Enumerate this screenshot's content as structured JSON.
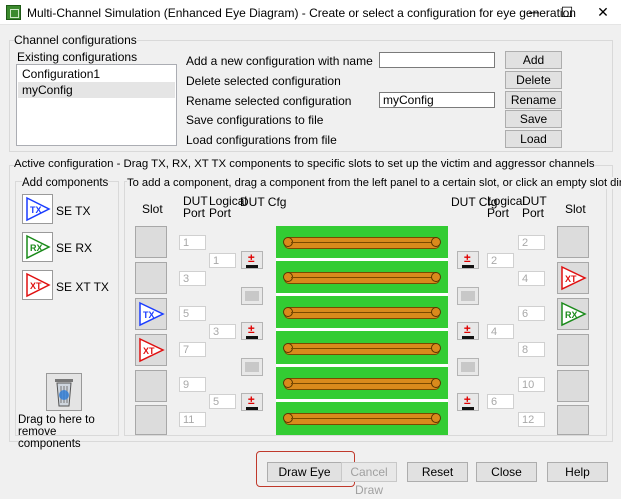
{
  "window": {
    "title": "Multi-Channel Simulation (Enhanced Eye Diagram) - Create or select a configuration for eye generation",
    "minimize": "─",
    "maximize": "☐",
    "close": "✕"
  },
  "channel_configurations": {
    "group_label": "Channel configurations",
    "existing_label": "Existing configurations",
    "items": [
      "Configuration1",
      "myConfig"
    ],
    "selected_index": 1,
    "add_label": "Add a new configuration with name",
    "add_value": "",
    "add_button": "Add",
    "delete_label": "Delete selected configuration",
    "delete_button": "Delete",
    "rename_label": "Rename selected configuration",
    "rename_value": "myConfig",
    "rename_button": "Rename",
    "save_label": "Save configurations to file",
    "save_button": "Save",
    "load_label": "Load configurations from file",
    "load_button": "Load"
  },
  "active_configuration": {
    "group_label": "Active configuration - Drag TX, RX, XT TX components to specific slots to set up the victim and aggressor channels",
    "add_components_label": "Add components",
    "components": [
      {
        "icon": "TX",
        "label": "SE TX",
        "color": "#1a3cff"
      },
      {
        "icon": "RX",
        "label": "SE RX",
        "color": "#1a8a1a"
      },
      {
        "icon": "XT",
        "label": "SE XT TX",
        "color": "#e01010"
      }
    ],
    "trash_label": "Drag to here to remove components",
    "instructions": "To add a component, drag a component from the left panel to a certain slot, or click an empty slot directly",
    "headers": {
      "slot_left": "Slot",
      "dut_port_left": "DUT Port",
      "logical_port_left": "Logical Port",
      "dut_cfg_left": "DUT Cfg",
      "dut_cfg_right": "DUT Cfg",
      "logical_port_right": "Logical Port",
      "dut_port_right": "DUT Port",
      "slot_right": "Slot"
    },
    "left_slots": [
      "",
      "",
      "TX",
      "XT",
      "",
      ""
    ],
    "right_slots": [
      "",
      "XT",
      "RX",
      "",
      "",
      ""
    ],
    "left_dut_ports": [
      "1",
      "3",
      "5",
      "7",
      "9",
      "11"
    ],
    "right_dut_ports": [
      "2",
      "4",
      "6",
      "8",
      "10",
      "12"
    ],
    "left_logical_ports": [
      "1",
      "3",
      "5"
    ],
    "right_logical_ports": [
      "2",
      "4",
      "6"
    ],
    "cfg_sign": "±"
  },
  "footer": {
    "draw_eye": "Draw Eye",
    "cancel_draw": "Cancel Draw",
    "reset": "Reset",
    "close": "Close",
    "help": "Help"
  },
  "colors": {
    "board": "#33cc33",
    "trace": "#d98a1c",
    "highlight": "#c0392b"
  }
}
